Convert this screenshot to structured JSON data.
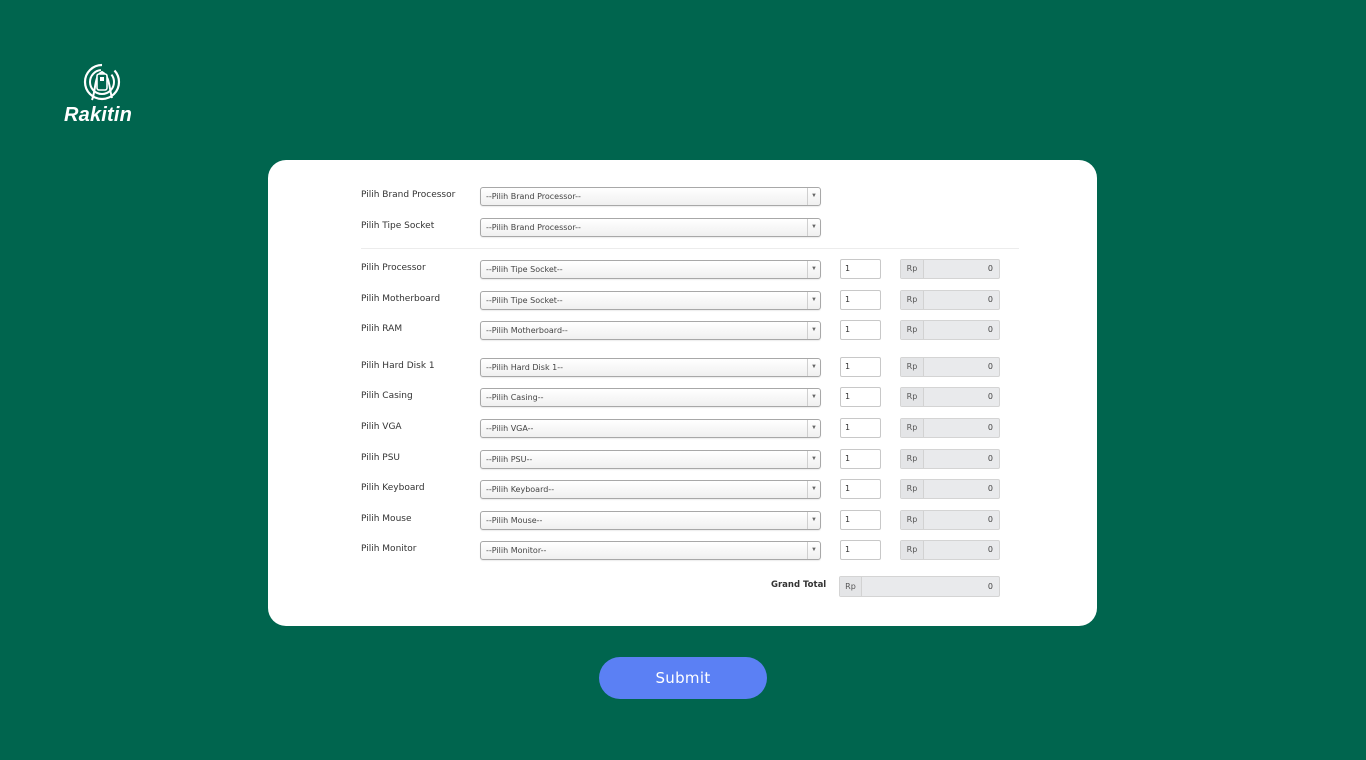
{
  "brand": {
    "name": "Rakitin",
    "logo_icon": "fingerprint-chip-icon"
  },
  "colors": {
    "background": "#00654e",
    "card": "#ffffff",
    "submit": "#5b80f4"
  },
  "top_fields": [
    {
      "label": "Pilih Brand Processor",
      "selected": "--Pilih Brand Processor--"
    },
    {
      "label": "Pilih Tipe Socket",
      "selected": "--Pilih Brand Processor--"
    }
  ],
  "components": [
    {
      "label": "Pilih Processor",
      "selected": "--Pilih Tipe Socket--",
      "qty": "1",
      "currency": "Rp",
      "price": "0"
    },
    {
      "label": "Pilih Motherboard",
      "selected": "--Pilih Tipe Socket--",
      "qty": "1",
      "currency": "Rp",
      "price": "0"
    },
    {
      "label": "Pilih RAM",
      "selected": "--Pilih Motherboard--",
      "qty": "1",
      "currency": "Rp",
      "price": "0"
    },
    {
      "label": "Pilih Hard Disk 1",
      "selected": "--Pilih Hard Disk 1--",
      "qty": "1",
      "currency": "Rp",
      "price": "0"
    },
    {
      "label": "Pilih Casing",
      "selected": "--Pilih Casing--",
      "qty": "1",
      "currency": "Rp",
      "price": "0"
    },
    {
      "label": "Pilih VGA",
      "selected": "--Pilih VGA--",
      "qty": "1",
      "currency": "Rp",
      "price": "0"
    },
    {
      "label": "Pilih PSU",
      "selected": "--Pilih PSU--",
      "qty": "1",
      "currency": "Rp",
      "price": "0"
    },
    {
      "label": "Pilih Keyboard",
      "selected": "--Pilih Keyboard--",
      "qty": "1",
      "currency": "Rp",
      "price": "0"
    },
    {
      "label": "Pilih Mouse",
      "selected": "--Pilih Mouse--",
      "qty": "1",
      "currency": "Rp",
      "price": "0"
    },
    {
      "label": "Pilih Monitor",
      "selected": "--Pilih Monitor--",
      "qty": "1",
      "currency": "Rp",
      "price": "0"
    }
  ],
  "grand_total": {
    "label": "Grand Total",
    "currency": "Rp",
    "value": "0"
  },
  "submit_label": "Submit"
}
